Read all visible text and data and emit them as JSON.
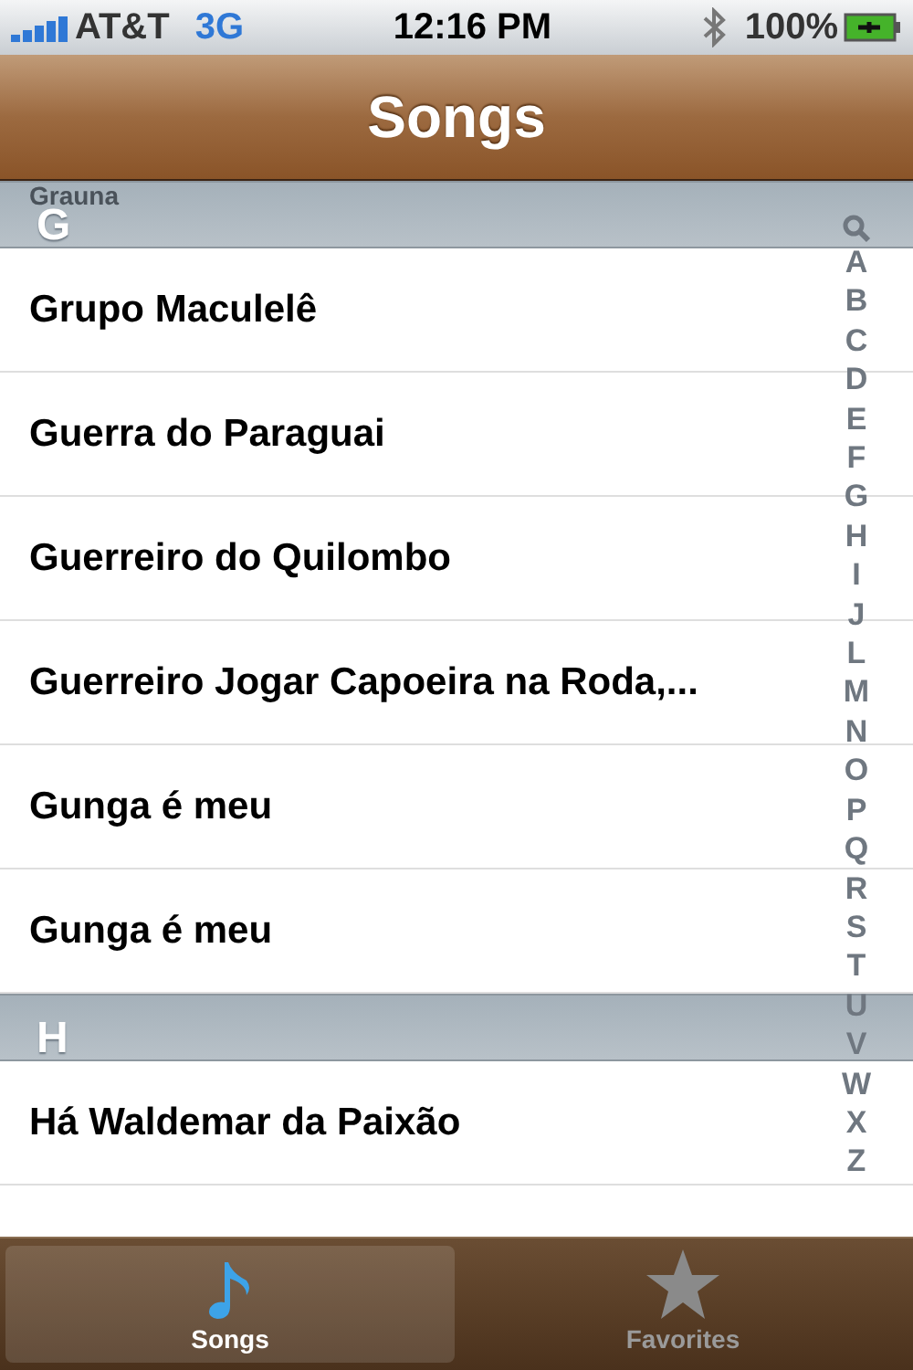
{
  "status_bar": {
    "carrier": "AT&T",
    "network": "3G",
    "time": "12:16 PM",
    "battery": "100%"
  },
  "nav_bar": {
    "title": "Songs"
  },
  "scrolled_row": "Grauna",
  "sections": [
    {
      "letter": "G",
      "rows": [
        "Grupo Maculelê",
        "Guerra do Paraguai",
        "Guerreiro do Quilombo",
        "Guerreiro Jogar Capoeira na Roda,...",
        "Gunga é meu",
        "Gunga é meu"
      ]
    },
    {
      "letter": "H",
      "rows": [
        "Há Waldemar da Paixão"
      ]
    }
  ],
  "index": [
    "A",
    "B",
    "C",
    "D",
    "E",
    "F",
    "G",
    "H",
    "I",
    "J",
    "L",
    "M",
    "N",
    "O",
    "P",
    "Q",
    "R",
    "S",
    "T",
    "U",
    "V",
    "W",
    "X",
    "Z"
  ],
  "tabs": [
    {
      "label": "Songs",
      "kind": "music",
      "selected": true
    },
    {
      "label": "Favorites",
      "kind": "star",
      "selected": false
    }
  ]
}
